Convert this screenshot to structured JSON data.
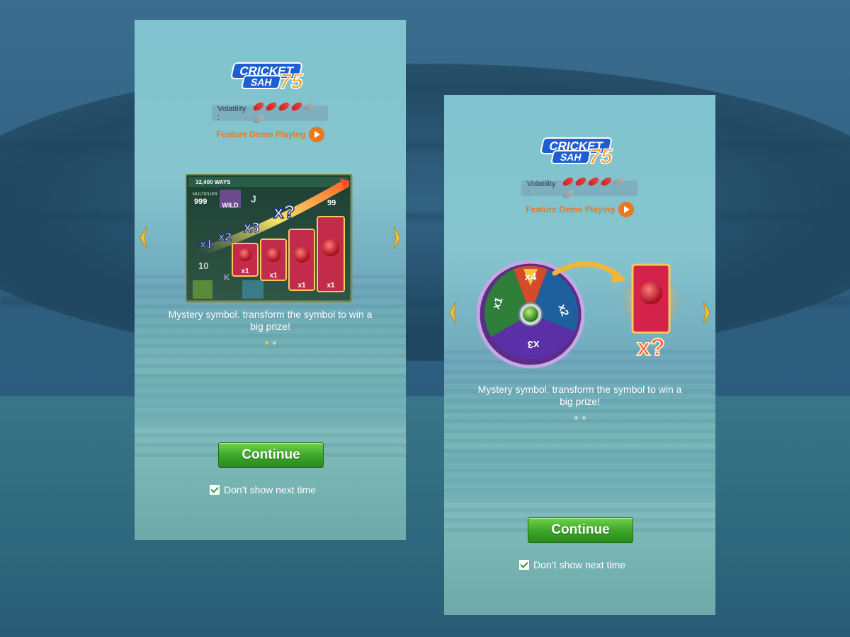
{
  "panels": [
    {
      "logo": {
        "line1": "CRICKET",
        "line2": "SAH",
        "number": "75"
      },
      "volatility_label": "Volatility :",
      "volatility": {
        "level": 4,
        "max": 6
      },
      "demo_text": "Feature Demo Playing",
      "feature": {
        "ways": "32,400 WAYS",
        "multiplier_label": "MULTIPLIER",
        "multiplier_value": "999",
        "multipliers": [
          "x1",
          "x2",
          "x3",
          "x?"
        ],
        "card_labels": [
          "x1",
          "x1",
          "x1",
          "x1"
        ],
        "wild": "WILD",
        "symbols": [
          "J",
          "K",
          "10",
          "99"
        ]
      },
      "description": "Mystery symbol. transform the symbol to win a big prize!",
      "continue_label": "Continue",
      "dont_show_label": "Don’t show next time"
    },
    {
      "logo": {
        "line1": "CRICKET",
        "line2": "SAH",
        "number": "75"
      },
      "volatility_label": "Volatility :",
      "volatility": {
        "level": 4,
        "max": 6
      },
      "demo_text": "Feature Demo Playing",
      "feature": {
        "wheel_segments": [
          "x4",
          "x2",
          "x3",
          "x1"
        ],
        "card_label": "x?"
      },
      "description": "Mystery symbol. transform the symbol to win a big prize!",
      "continue_label": "Continue",
      "dont_show_label": "Don’t show next time"
    }
  ],
  "colors": {
    "accent_orange": "#e67a1e",
    "button_green": "#3ea82a",
    "chili_red": "#d2262c",
    "dot_active": "#e9c24a"
  }
}
